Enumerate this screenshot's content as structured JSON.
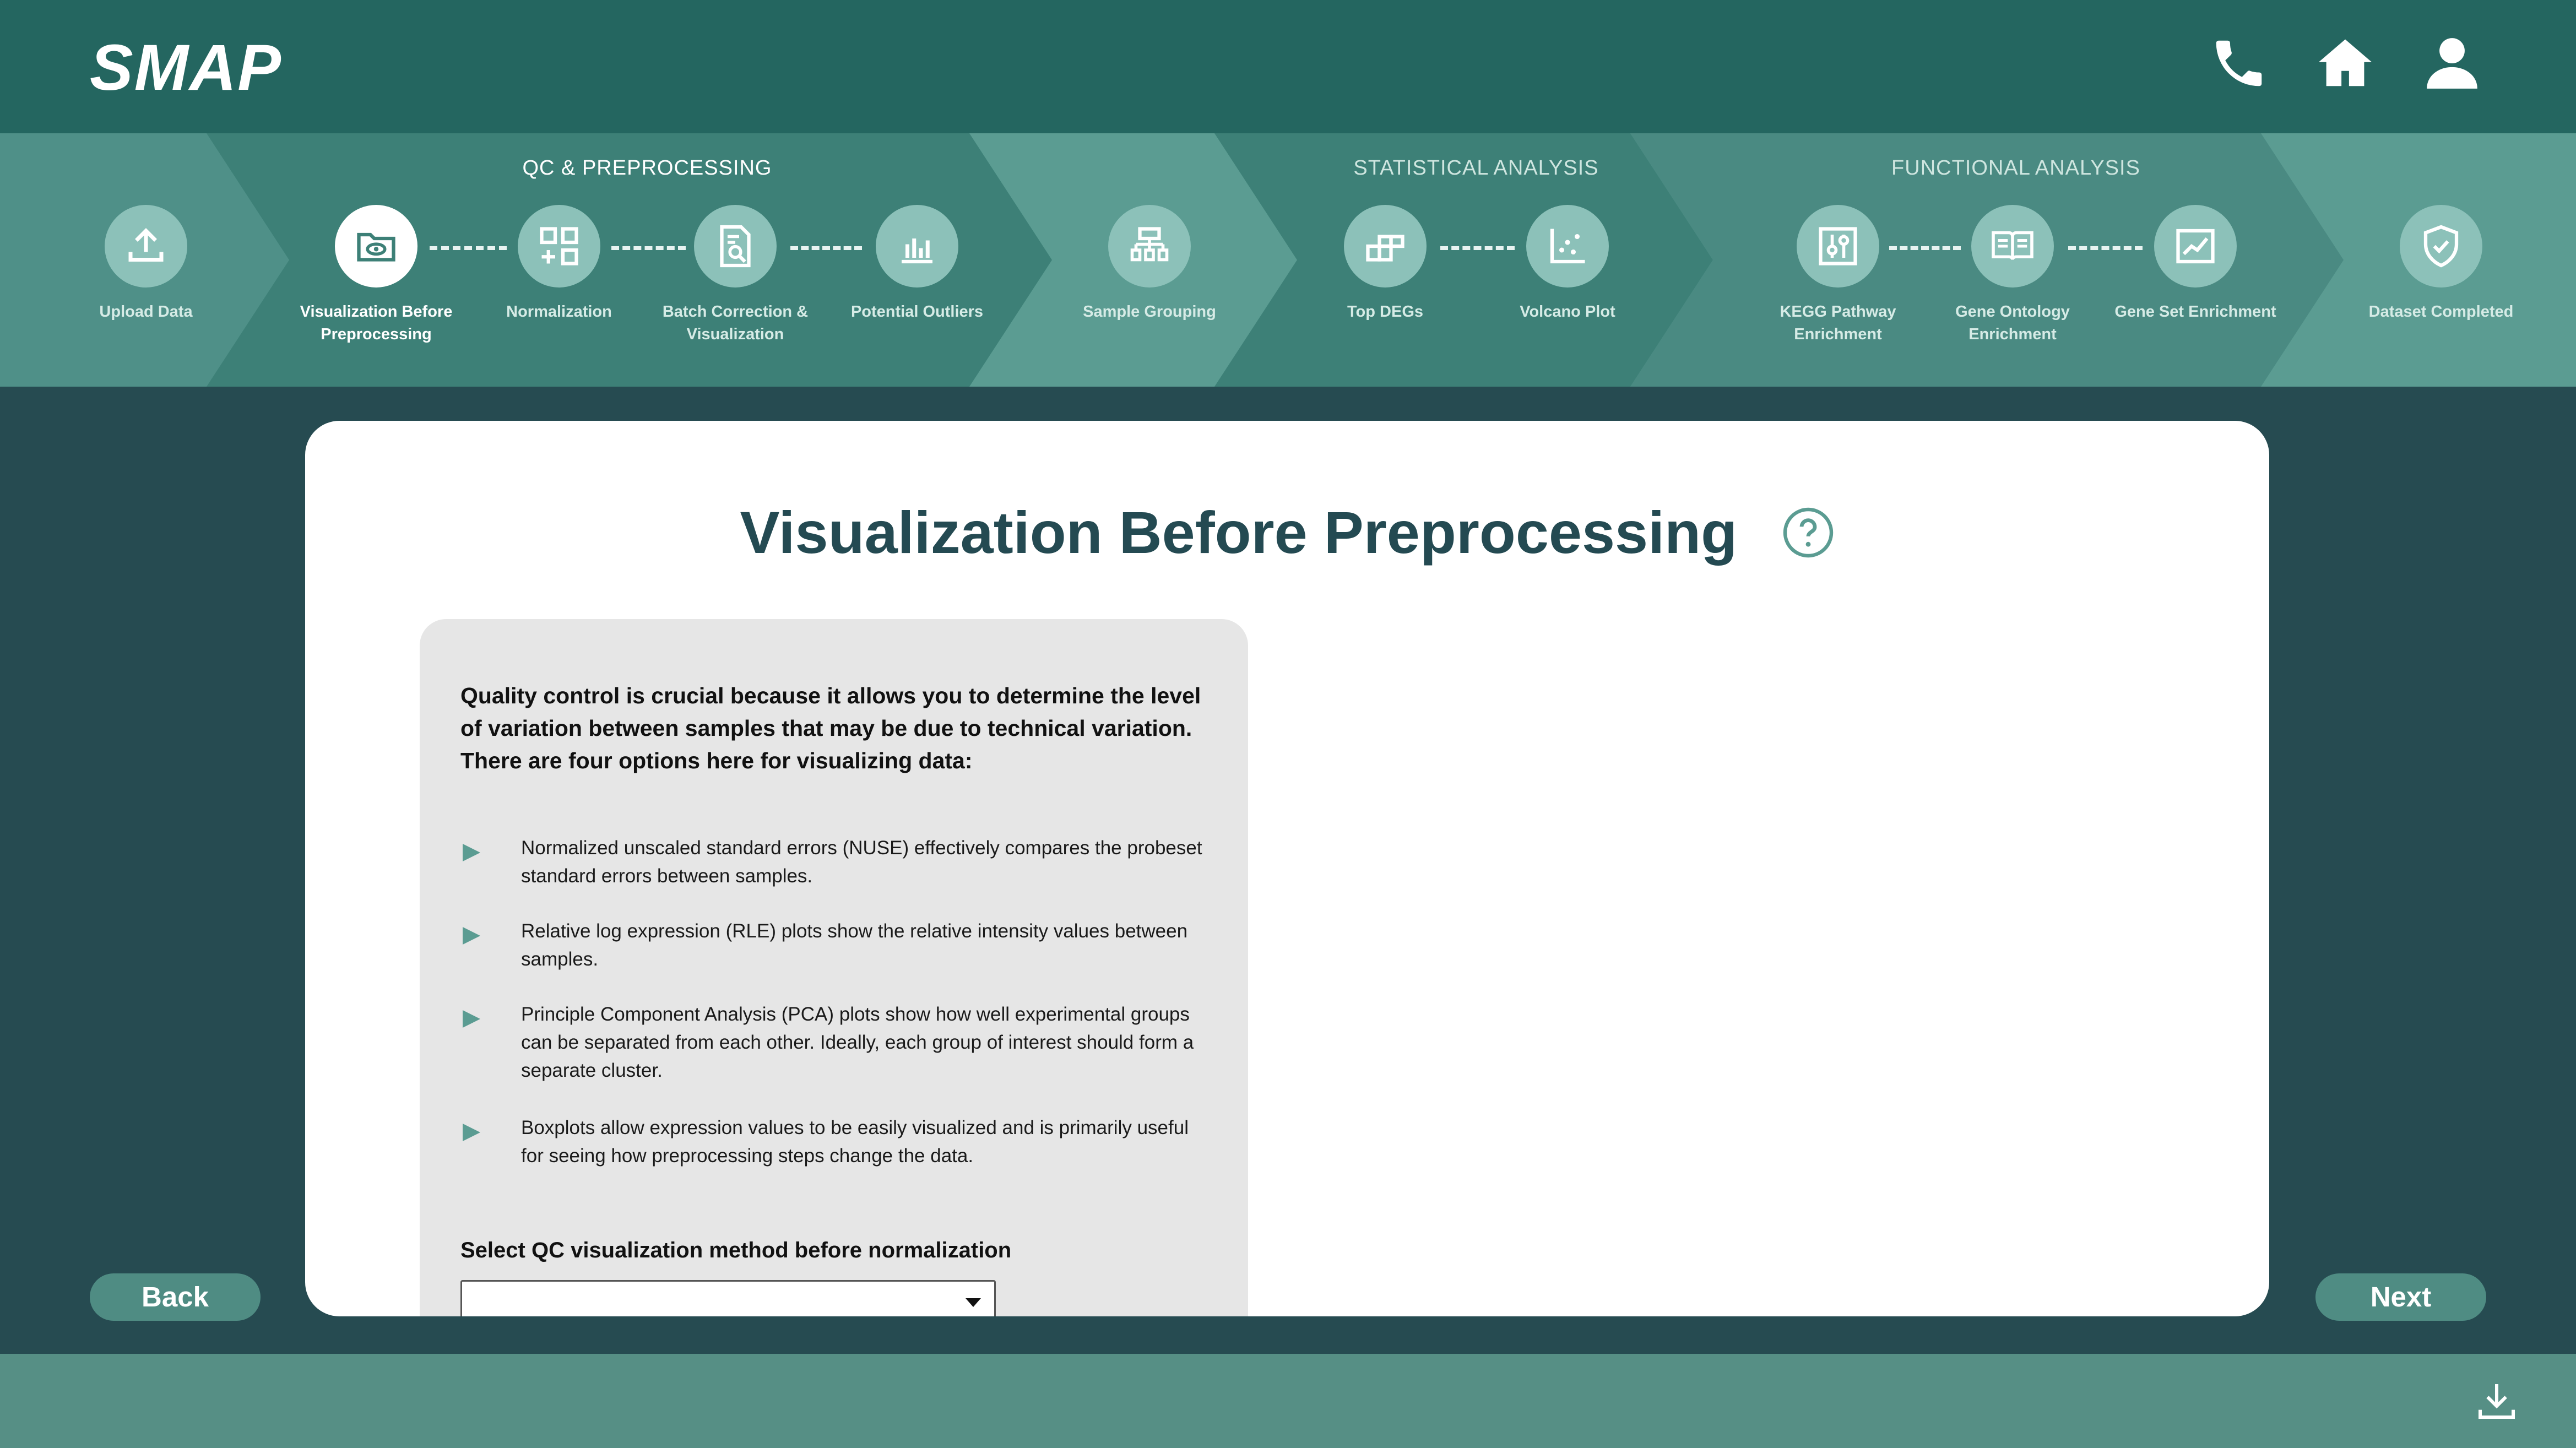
{
  "app": {
    "logo": "SMAP"
  },
  "header_icons": [
    "phone-icon",
    "home-icon",
    "user-icon"
  ],
  "stepper": {
    "groups": [
      "QC & PREPROCESSING",
      "STATISTICAL ANALYSIS",
      "FUNCTIONAL ANALYSIS"
    ],
    "steps": [
      {
        "label": "Upload Data",
        "icon": "upload-icon"
      },
      {
        "label": "Visualization Before Preprocessing",
        "icon": "folder-eye-icon",
        "active": true
      },
      {
        "label": "Normalization",
        "icon": "grid-plus-icon"
      },
      {
        "label": "Batch Correction & Visualization",
        "icon": "document-search-icon"
      },
      {
        "label": "Potential Outliers",
        "icon": "bar-chart-icon"
      },
      {
        "label": "Sample Grouping",
        "icon": "hierarchy-icon"
      },
      {
        "label": "Top DEGs",
        "icon": "blocks-icon"
      },
      {
        "label": "Volcano Plot",
        "icon": "scatter-icon"
      },
      {
        "label": "KEGG Pathway Enrichment",
        "icon": "sliders-icon"
      },
      {
        "label": "Gene Ontology Enrichment",
        "icon": "book-icon"
      },
      {
        "label": "Gene Set Enrichment",
        "icon": "line-chart-icon"
      },
      {
        "label": "Dataset Completed",
        "icon": "shield-check-icon"
      }
    ]
  },
  "main": {
    "title": "Visualization Before Preprocessing",
    "intro": "Quality control is crucial because it allows you to determine the level of variation between samples that may be due to technical variation. There are four options here for visualizing data:",
    "bullets": [
      "Normalized unscaled standard errors (NUSE) effectively compares the probeset standard errors between samples.",
      "Relative log expression (RLE) plots show the relative intensity values between samples.",
      "Principle Component Analysis (PCA) plots show how well experimental groups can be separated from each other. Ideally, each group of interest should form a separate cluster.",
      "Boxplots allow expression values to be easily visualized and is primarily useful for seeing how preprocessing steps change the data."
    ],
    "select_label": "Select QC visualization method before normalization",
    "select_value": ""
  },
  "nav": {
    "back": "Back",
    "next": "Next"
  },
  "colors": {
    "header": "#246660",
    "background": "#264b51",
    "accent": "#5b9c92",
    "footer": "#568f85",
    "button": "#4f8c83"
  }
}
